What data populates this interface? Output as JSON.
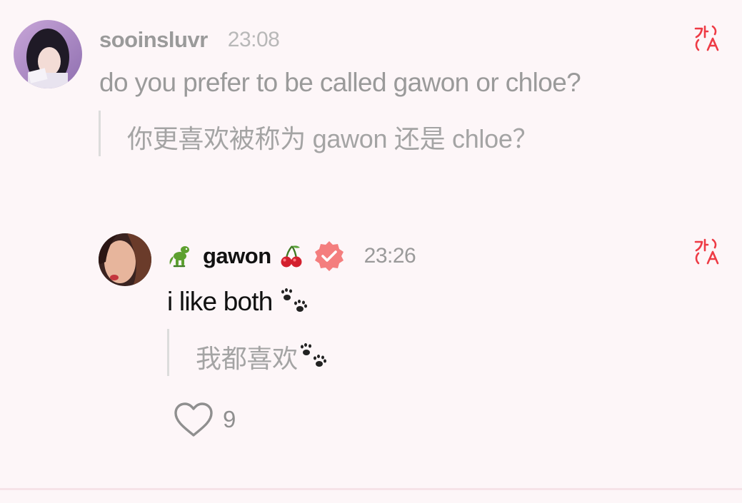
{
  "comment": {
    "username": "sooinsluvr",
    "time": "23:08",
    "text": "do you prefer to be called gawon or chloe?",
    "translation": "你更喜欢被称为 gawon 还是 chloe？",
    "translate_icon": "translate-icon"
  },
  "reply": {
    "username": "gawon",
    "username_prefix_icon": "dinosaur-emoji",
    "username_suffix_icon": "cherries-emoji",
    "verified_icon": "verified-badge-icon",
    "time": "23:26",
    "text": "i like both",
    "text_icon": "paw-prints-emoji",
    "translation": "我都喜欢",
    "translation_icon": "paw-prints-emoji",
    "translate_icon": "translate-icon",
    "like_icon": "heart-outline-icon",
    "like_count": "9"
  },
  "colors": {
    "background": "#fdf6f8",
    "accent_red": "#ee3b45",
    "badge_pink": "#f47e7e",
    "muted_text": "#9a9a9a"
  }
}
